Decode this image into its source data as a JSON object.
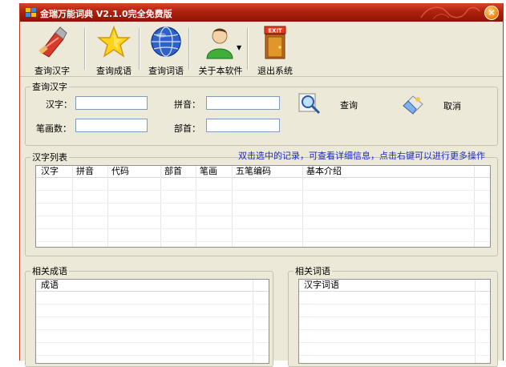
{
  "window": {
    "title": "金瑞万能词典 V2.1.0完全免费版",
    "close_symbol": "×"
  },
  "toolbar": {
    "buttons": [
      {
        "label": "查询汉字",
        "icon": "brush-icon"
      },
      {
        "label": "查询成语",
        "icon": "star-icon"
      },
      {
        "label": "查询词语",
        "icon": "globe-icon"
      },
      {
        "label": "关于本软件",
        "icon": "user-icon"
      },
      {
        "label": "退出系统",
        "icon": "exit-door-icon"
      }
    ],
    "exit_sign": "EXIT"
  },
  "search_panel": {
    "legend": "查询汉字",
    "hanzi_label": "汉字：",
    "pinyin_label": "拼音：",
    "strokes_label": "笔画数：",
    "radical_label": "部首：",
    "hanzi_value": "",
    "pinyin_value": "",
    "strokes_value": "",
    "radical_value": "",
    "query_label": "查询",
    "cancel_label": "取消"
  },
  "char_list": {
    "legend": "汉字列表",
    "hint": "双击选中的记录，可查看详细信息，点击右键可以进行更多操作",
    "columns": [
      "汉字",
      "拼音",
      "代码",
      "部首",
      "笔画",
      "五笔编码",
      "基本介绍"
    ]
  },
  "idiom_panel": {
    "legend": "相关成语",
    "columns": [
      "成语"
    ]
  },
  "word_panel": {
    "legend": "相关词语",
    "columns": [
      "汉字词语"
    ]
  },
  "colors": {
    "titlebar": "#b0210e",
    "window_bg": "#ece9d8",
    "hint_text": "#1a2acb",
    "frame": "#b53a1c"
  }
}
